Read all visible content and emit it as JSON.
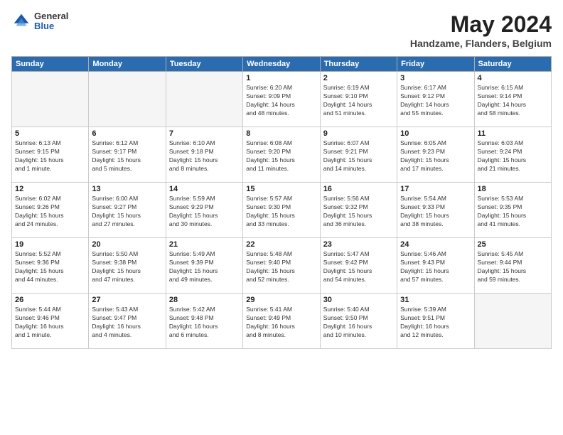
{
  "header": {
    "logo_general": "General",
    "logo_blue": "Blue",
    "title": "May 2024",
    "location": "Handzame, Flanders, Belgium"
  },
  "days_of_week": [
    "Sunday",
    "Monday",
    "Tuesday",
    "Wednesday",
    "Thursday",
    "Friday",
    "Saturday"
  ],
  "weeks": [
    [
      {
        "day": "",
        "info": ""
      },
      {
        "day": "",
        "info": ""
      },
      {
        "day": "",
        "info": ""
      },
      {
        "day": "1",
        "info": "Sunrise: 6:20 AM\nSunset: 9:09 PM\nDaylight: 14 hours\nand 48 minutes."
      },
      {
        "day": "2",
        "info": "Sunrise: 6:19 AM\nSunset: 9:10 PM\nDaylight: 14 hours\nand 51 minutes."
      },
      {
        "day": "3",
        "info": "Sunrise: 6:17 AM\nSunset: 9:12 PM\nDaylight: 14 hours\nand 55 minutes."
      },
      {
        "day": "4",
        "info": "Sunrise: 6:15 AM\nSunset: 9:14 PM\nDaylight: 14 hours\nand 58 minutes."
      }
    ],
    [
      {
        "day": "5",
        "info": "Sunrise: 6:13 AM\nSunset: 9:15 PM\nDaylight: 15 hours\nand 1 minute."
      },
      {
        "day": "6",
        "info": "Sunrise: 6:12 AM\nSunset: 9:17 PM\nDaylight: 15 hours\nand 5 minutes."
      },
      {
        "day": "7",
        "info": "Sunrise: 6:10 AM\nSunset: 9:18 PM\nDaylight: 15 hours\nand 8 minutes."
      },
      {
        "day": "8",
        "info": "Sunrise: 6:08 AM\nSunset: 9:20 PM\nDaylight: 15 hours\nand 11 minutes."
      },
      {
        "day": "9",
        "info": "Sunrise: 6:07 AM\nSunset: 9:21 PM\nDaylight: 15 hours\nand 14 minutes."
      },
      {
        "day": "10",
        "info": "Sunrise: 6:05 AM\nSunset: 9:23 PM\nDaylight: 15 hours\nand 17 minutes."
      },
      {
        "day": "11",
        "info": "Sunrise: 6:03 AM\nSunset: 9:24 PM\nDaylight: 15 hours\nand 21 minutes."
      }
    ],
    [
      {
        "day": "12",
        "info": "Sunrise: 6:02 AM\nSunset: 9:26 PM\nDaylight: 15 hours\nand 24 minutes."
      },
      {
        "day": "13",
        "info": "Sunrise: 6:00 AM\nSunset: 9:27 PM\nDaylight: 15 hours\nand 27 minutes."
      },
      {
        "day": "14",
        "info": "Sunrise: 5:59 AM\nSunset: 9:29 PM\nDaylight: 15 hours\nand 30 minutes."
      },
      {
        "day": "15",
        "info": "Sunrise: 5:57 AM\nSunset: 9:30 PM\nDaylight: 15 hours\nand 33 minutes."
      },
      {
        "day": "16",
        "info": "Sunrise: 5:56 AM\nSunset: 9:32 PM\nDaylight: 15 hours\nand 36 minutes."
      },
      {
        "day": "17",
        "info": "Sunrise: 5:54 AM\nSunset: 9:33 PM\nDaylight: 15 hours\nand 38 minutes."
      },
      {
        "day": "18",
        "info": "Sunrise: 5:53 AM\nSunset: 9:35 PM\nDaylight: 15 hours\nand 41 minutes."
      }
    ],
    [
      {
        "day": "19",
        "info": "Sunrise: 5:52 AM\nSunset: 9:36 PM\nDaylight: 15 hours\nand 44 minutes."
      },
      {
        "day": "20",
        "info": "Sunrise: 5:50 AM\nSunset: 9:38 PM\nDaylight: 15 hours\nand 47 minutes."
      },
      {
        "day": "21",
        "info": "Sunrise: 5:49 AM\nSunset: 9:39 PM\nDaylight: 15 hours\nand 49 minutes."
      },
      {
        "day": "22",
        "info": "Sunrise: 5:48 AM\nSunset: 9:40 PM\nDaylight: 15 hours\nand 52 minutes."
      },
      {
        "day": "23",
        "info": "Sunrise: 5:47 AM\nSunset: 9:42 PM\nDaylight: 15 hours\nand 54 minutes."
      },
      {
        "day": "24",
        "info": "Sunrise: 5:46 AM\nSunset: 9:43 PM\nDaylight: 15 hours\nand 57 minutes."
      },
      {
        "day": "25",
        "info": "Sunrise: 5:45 AM\nSunset: 9:44 PM\nDaylight: 15 hours\nand 59 minutes."
      }
    ],
    [
      {
        "day": "26",
        "info": "Sunrise: 5:44 AM\nSunset: 9:46 PM\nDaylight: 16 hours\nand 1 minute."
      },
      {
        "day": "27",
        "info": "Sunrise: 5:43 AM\nSunset: 9:47 PM\nDaylight: 16 hours\nand 4 minutes."
      },
      {
        "day": "28",
        "info": "Sunrise: 5:42 AM\nSunset: 9:48 PM\nDaylight: 16 hours\nand 6 minutes."
      },
      {
        "day": "29",
        "info": "Sunrise: 5:41 AM\nSunset: 9:49 PM\nDaylight: 16 hours\nand 8 minutes."
      },
      {
        "day": "30",
        "info": "Sunrise: 5:40 AM\nSunset: 9:50 PM\nDaylight: 16 hours\nand 10 minutes."
      },
      {
        "day": "31",
        "info": "Sunrise: 5:39 AM\nSunset: 9:51 PM\nDaylight: 16 hours\nand 12 minutes."
      },
      {
        "day": "",
        "info": ""
      }
    ]
  ]
}
